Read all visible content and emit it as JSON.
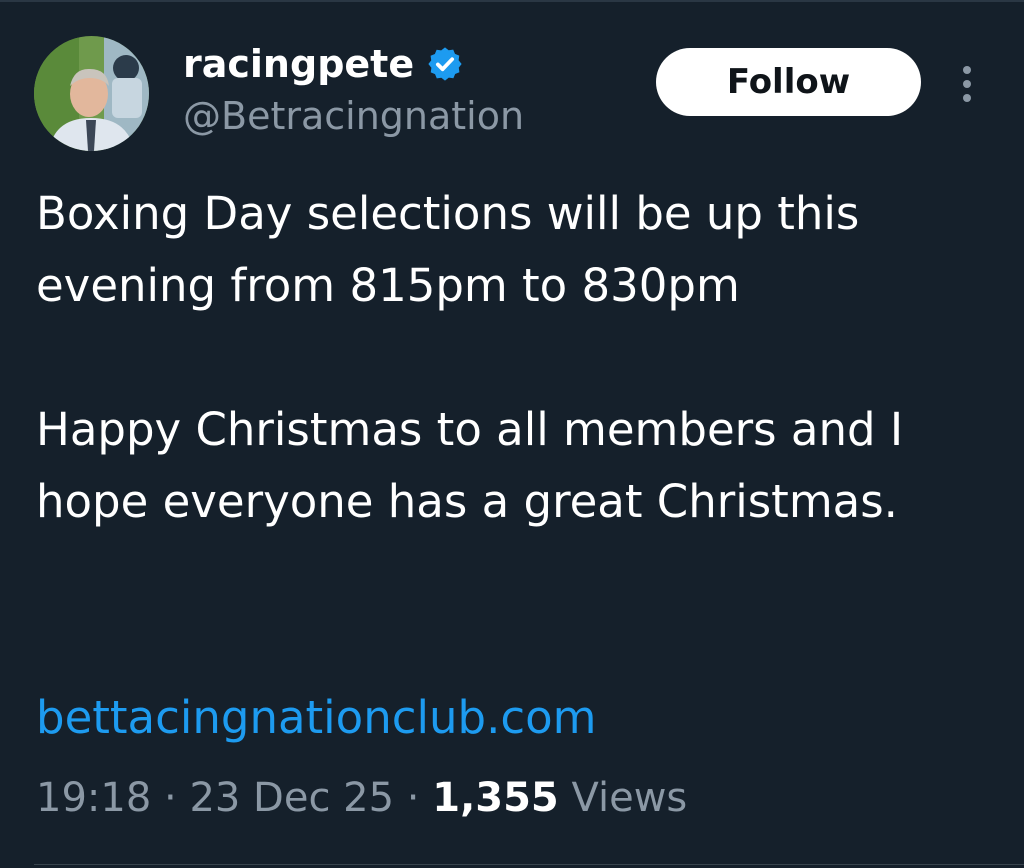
{
  "user": {
    "display_name": "racingpete",
    "handle": "@Betracingnation",
    "verified": true
  },
  "actions": {
    "follow_label": "Follow"
  },
  "tweet": {
    "paragraphs": [
      "Boxing Day selections will be up this evening from 815pm to 830pm",
      "Happy Christmas to all members and I hope everyone has a great Christmas."
    ],
    "link": "bettacingnationclub.com"
  },
  "meta": {
    "time": "19:18",
    "separator": " · ",
    "date": "23 Dec 25",
    "views_count": "1,355",
    "views_label": "Views"
  },
  "colors": {
    "background": "#15202b",
    "accent": "#1d9bf0",
    "muted_text": "#8b98a5",
    "verified_badge": "#1d9bf0"
  },
  "icons": {
    "verified": "verified-badge-icon",
    "more": "more-options-icon"
  }
}
